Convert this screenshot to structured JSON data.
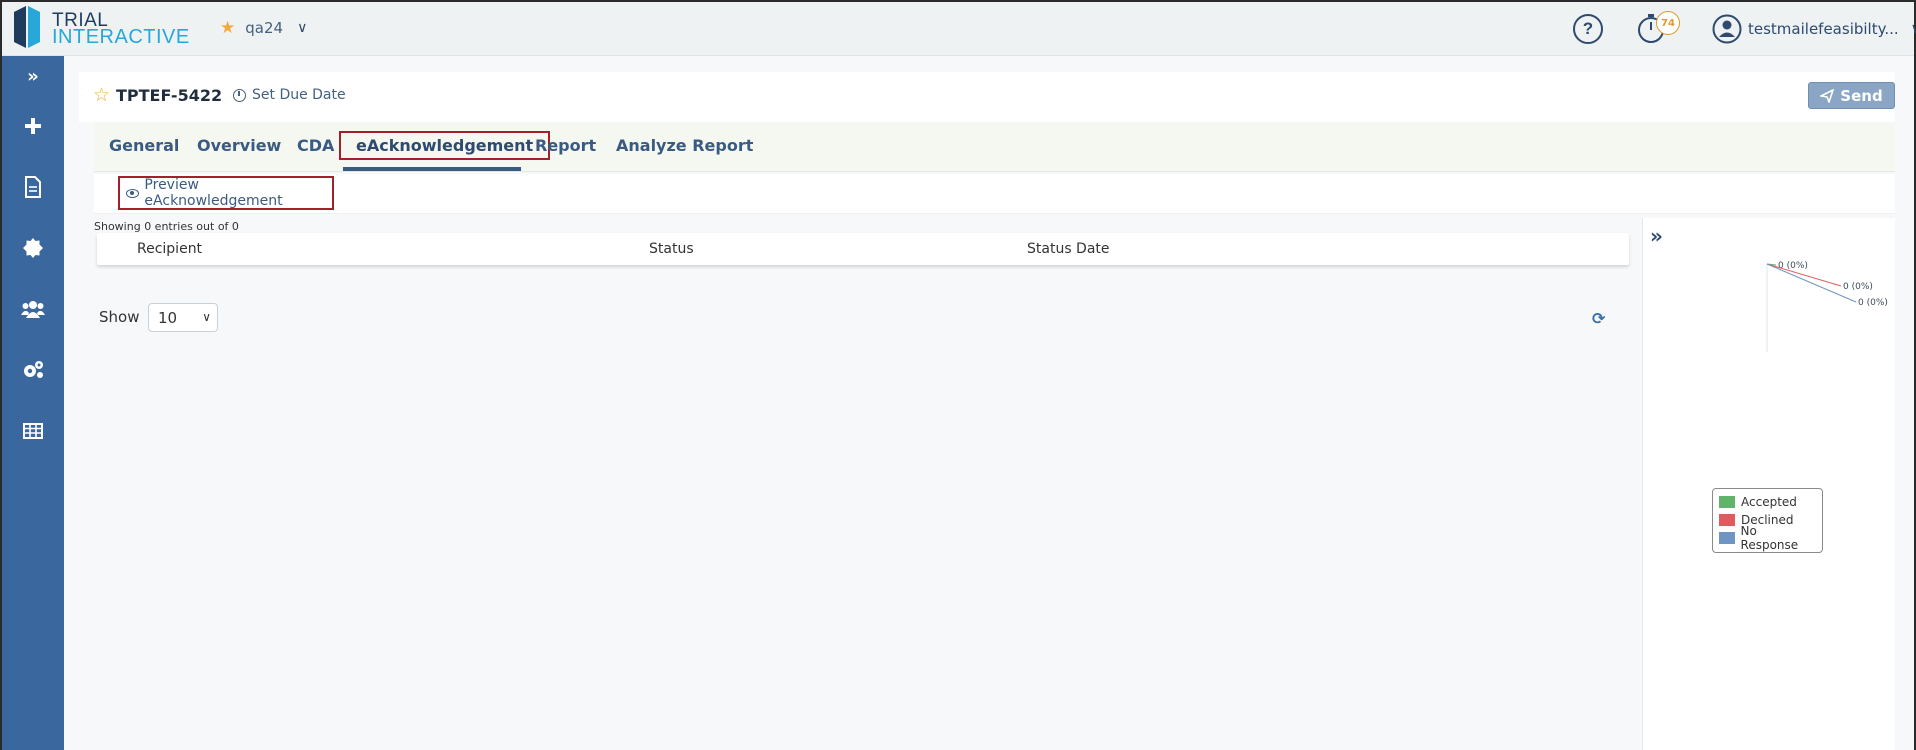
{
  "app": {
    "logo_line1": "TRIAL",
    "logo_line2": "INTERACTIVE",
    "project": "qa24",
    "timer_count": "74",
    "user_name": "testmailefeasibilty..."
  },
  "record": {
    "id": "TPTEF-5422",
    "due_label": "Set Due Date",
    "send_label": "Send"
  },
  "tabs": [
    {
      "label": "General"
    },
    {
      "label": "Overview"
    },
    {
      "label": "CDA"
    },
    {
      "label": "eAcknowledgement"
    },
    {
      "label": "Report"
    },
    {
      "label": "Analyze Report"
    }
  ],
  "toolbar": {
    "preview_label": "Preview eAcknowledgement"
  },
  "table": {
    "showing_text": "Showing 0 entries out of 0",
    "columns": [
      "Recipient",
      "Status",
      "Status Date"
    ]
  },
  "pager": {
    "show_label": "Show",
    "page_size": "10"
  },
  "chart_data": {
    "type": "pie",
    "categories": [
      "Accepted",
      "Declined",
      "No Response"
    ],
    "values": [
      0,
      0,
      0
    ],
    "data_labels": [
      "0 (0%)",
      "0 (0%)",
      "0 (0%)"
    ],
    "colors": [
      "#5fb36b",
      "#e05c5c",
      "#6f95c2"
    ],
    "legend_position": "bottom"
  },
  "colors": {
    "sidebar": "#3a679d",
    "accent": "#3b5a82",
    "highlight_border": "#a31f2a"
  }
}
